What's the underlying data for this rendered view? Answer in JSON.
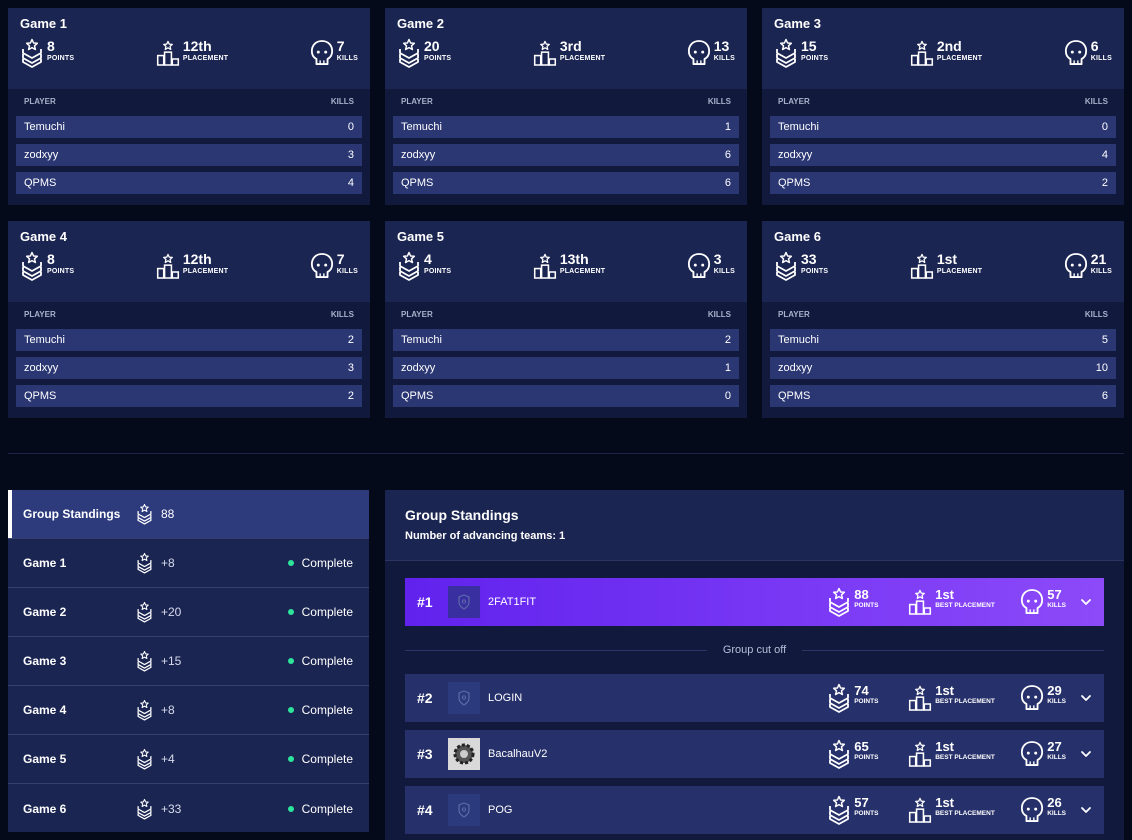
{
  "games": [
    {
      "title": "Game 1",
      "points": "8",
      "points_label": "POINTS",
      "placement": "12th",
      "placement_label": "PLACEMENT",
      "kills": "7",
      "kills_label": "KILLS",
      "col_player": "PLAYER",
      "col_kills": "KILLS",
      "players": [
        {
          "name": "Temuchi",
          "kills": "0"
        },
        {
          "name": "zodxyy",
          "kills": "3"
        },
        {
          "name": "QPMS",
          "kills": "4"
        }
      ]
    },
    {
      "title": "Game 2",
      "points": "20",
      "points_label": "POINTS",
      "placement": "3rd",
      "placement_label": "PLACEMENT",
      "kills": "13",
      "kills_label": "KILLS",
      "col_player": "PLAYER",
      "col_kills": "KILLS",
      "players": [
        {
          "name": "Temuchi",
          "kills": "1"
        },
        {
          "name": "zodxyy",
          "kills": "6"
        },
        {
          "name": "QPMS",
          "kills": "6"
        }
      ]
    },
    {
      "title": "Game 3",
      "points": "15",
      "points_label": "POINTS",
      "placement": "2nd",
      "placement_label": "PLACEMENT",
      "kills": "6",
      "kills_label": "KILLS",
      "col_player": "PLAYER",
      "col_kills": "KILLS",
      "players": [
        {
          "name": "Temuchi",
          "kills": "0"
        },
        {
          "name": "zodxyy",
          "kills": "4"
        },
        {
          "name": "QPMS",
          "kills": "2"
        }
      ]
    },
    {
      "title": "Game 4",
      "points": "8",
      "points_label": "POINTS",
      "placement": "12th",
      "placement_label": "PLACEMENT",
      "kills": "7",
      "kills_label": "KILLS",
      "col_player": "PLAYER",
      "col_kills": "KILLS",
      "players": [
        {
          "name": "Temuchi",
          "kills": "2"
        },
        {
          "name": "zodxyy",
          "kills": "3"
        },
        {
          "name": "QPMS",
          "kills": "2"
        }
      ]
    },
    {
      "title": "Game 5",
      "points": "4",
      "points_label": "POINTS",
      "placement": "13th",
      "placement_label": "PLACEMENT",
      "kills": "3",
      "kills_label": "KILLS",
      "col_player": "PLAYER",
      "col_kills": "KILLS",
      "players": [
        {
          "name": "Temuchi",
          "kills": "2"
        },
        {
          "name": "zodxyy",
          "kills": "1"
        },
        {
          "name": "QPMS",
          "kills": "0"
        }
      ]
    },
    {
      "title": "Game 6",
      "points": "33",
      "points_label": "POINTS",
      "placement": "1st",
      "placement_label": "PLACEMENT",
      "kills": "21",
      "kills_label": "KILLS",
      "col_player": "PLAYER",
      "col_kills": "KILLS",
      "players": [
        {
          "name": "Temuchi",
          "kills": "5"
        },
        {
          "name": "zodxyy",
          "kills": "10"
        },
        {
          "name": "QPMS",
          "kills": "6"
        }
      ]
    }
  ],
  "sidebar": {
    "items": [
      {
        "label": "Group Standings",
        "value": "88",
        "status": "",
        "active": true
      },
      {
        "label": "Game 1",
        "value": "+8",
        "status": "Complete"
      },
      {
        "label": "Game 2",
        "value": "+20",
        "status": "Complete"
      },
      {
        "label": "Game 3",
        "value": "+15",
        "status": "Complete"
      },
      {
        "label": "Game 4",
        "value": "+8",
        "status": "Complete"
      },
      {
        "label": "Game 5",
        "value": "+4",
        "status": "Complete"
      },
      {
        "label": "Game 6",
        "value": "+33",
        "status": "Complete"
      }
    ],
    "status_color": "#2ce59a"
  },
  "standings": {
    "title": "Group Standings",
    "subtitle": "Number of advancing teams: 1",
    "cutoff_label": "Group cut off",
    "points_label": "POINTS",
    "placement_label": "BEST PLACEMENT",
    "kills_label": "KILLS",
    "teams": [
      {
        "rank": "#1",
        "name": "2FAT1FIT",
        "points": "88",
        "placement": "1st",
        "kills": "57",
        "logo": "shield-icon"
      },
      {
        "rank": "#2",
        "name": "LOGIN",
        "points": "74",
        "placement": "1st",
        "kills": "29",
        "logo": "shield-icon"
      },
      {
        "rank": "#3",
        "name": "BacalhauV2",
        "points": "65",
        "placement": "1st",
        "kills": "27",
        "logo": "team-avatar"
      },
      {
        "rank": "#4",
        "name": "POG",
        "points": "57",
        "placement": "1st",
        "kills": "26",
        "logo": "shield-icon"
      }
    ],
    "accent_gradient": [
      "#6122ee",
      "#8c4af9"
    ]
  }
}
